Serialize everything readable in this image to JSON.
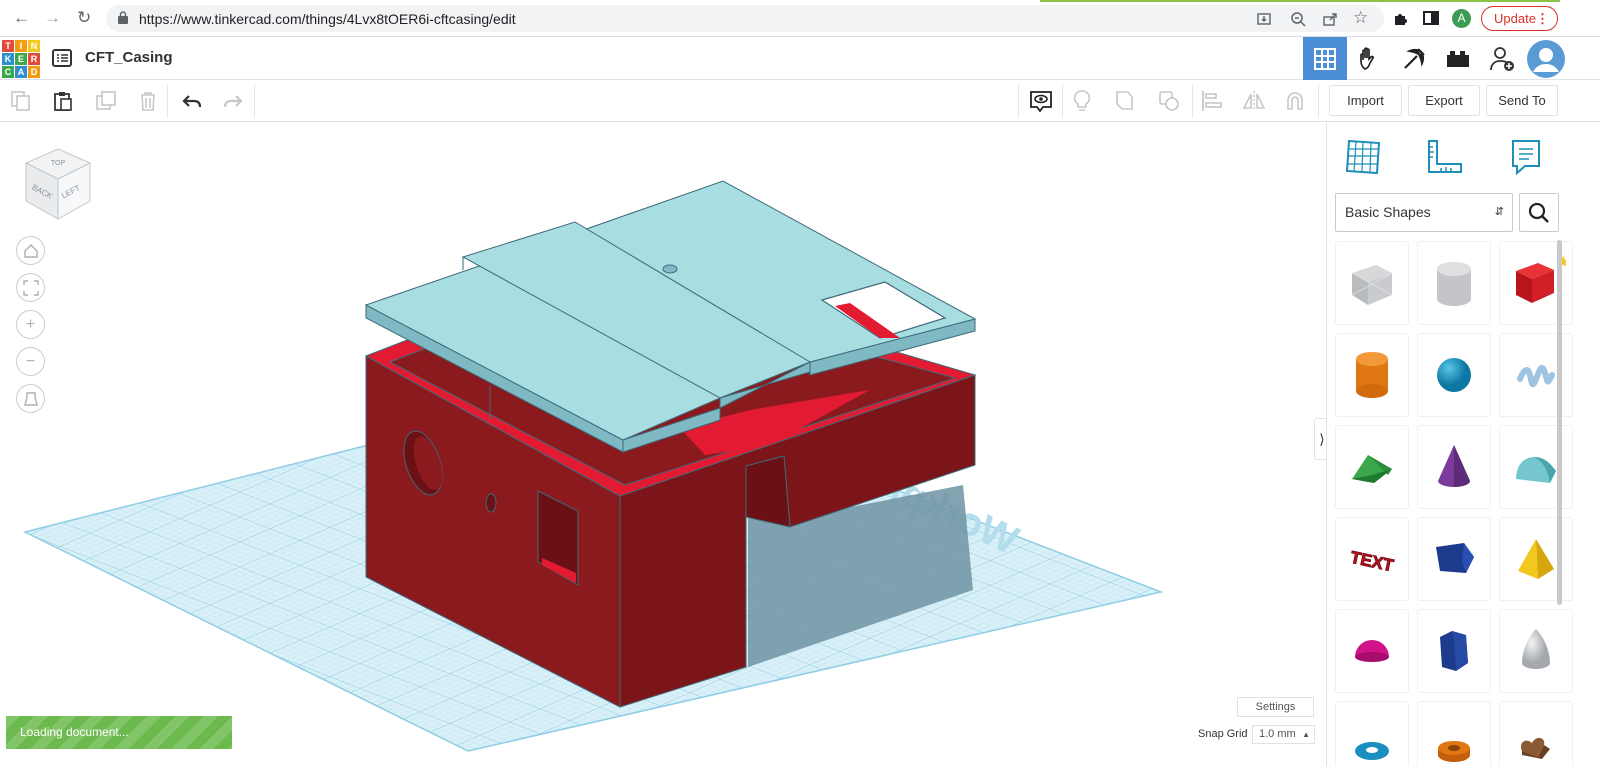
{
  "browser": {
    "url": "https://www.tinkercad.com/things/4Lvx8tOER6i-cftcasing/edit",
    "profile_initial": "A",
    "update_label": "Update"
  },
  "app": {
    "logo_letters": [
      "T",
      "I",
      "N",
      "K",
      "E",
      "R",
      "C",
      "A",
      "D"
    ],
    "logo_colors": [
      "#e14b3b",
      "#f39c12",
      "#f2c81f",
      "#2e8fcd",
      "#3ca84c",
      "#e14b3b",
      "#3ca84c",
      "#2e8fcd",
      "#f39c12"
    ],
    "project_name": "CFT_Casing",
    "header_buttons": [
      "3d-design-view-icon",
      "blocks-hand-icon",
      "pickaxe-icon",
      "bricks-icon",
      "add-user-icon",
      "user-avatar-icon"
    ]
  },
  "toolbar": {
    "tools": [
      "copy-icon",
      "paste-icon",
      "duplicate-icon",
      "delete-icon",
      "undo-icon",
      "redo-icon",
      "note-icon",
      "light-bulb-icon",
      "group-icon",
      "ungroup-icon",
      "align-icon",
      "mirror-icon",
      "cruise-icon"
    ],
    "import_label": "Import",
    "export_label": "Export",
    "send_to_label": "Send To"
  },
  "viewcube": {
    "faces": [
      "TOP",
      "BACK",
      "LEFT"
    ]
  },
  "workplane": {
    "label": "Workplane"
  },
  "status": {
    "loading_text": "Loading document...",
    "settings_label": "Settings",
    "snap_grid_label": "Snap Grid",
    "snap_grid_value": "1.0 mm"
  },
  "panel": {
    "category": "Basic Shapes",
    "shapes": [
      "box-hole-shape",
      "cylinder-hole-shape",
      "box-shape",
      "cylinder-shape",
      "sphere-shape",
      "scribble-shape",
      "roof-shape",
      "cone-shape",
      "round-roof-shape",
      "text-shape",
      "polygon-shape",
      "pyramid-shape",
      "half-sphere-shape",
      "hexagonal-prism-shape",
      "paraboloid-shape",
      "torus-shape",
      "tube-shape",
      "heart-shape"
    ],
    "shape_text_label": "TEXT"
  },
  "colors": {
    "accent": "#4a8fd6",
    "casing_red": "#8b1a1f",
    "casing_bright_red": "#e21b33",
    "lid": "#a8dde2",
    "grid": "#cfeaf5",
    "loading_green": "#6cba4d"
  }
}
